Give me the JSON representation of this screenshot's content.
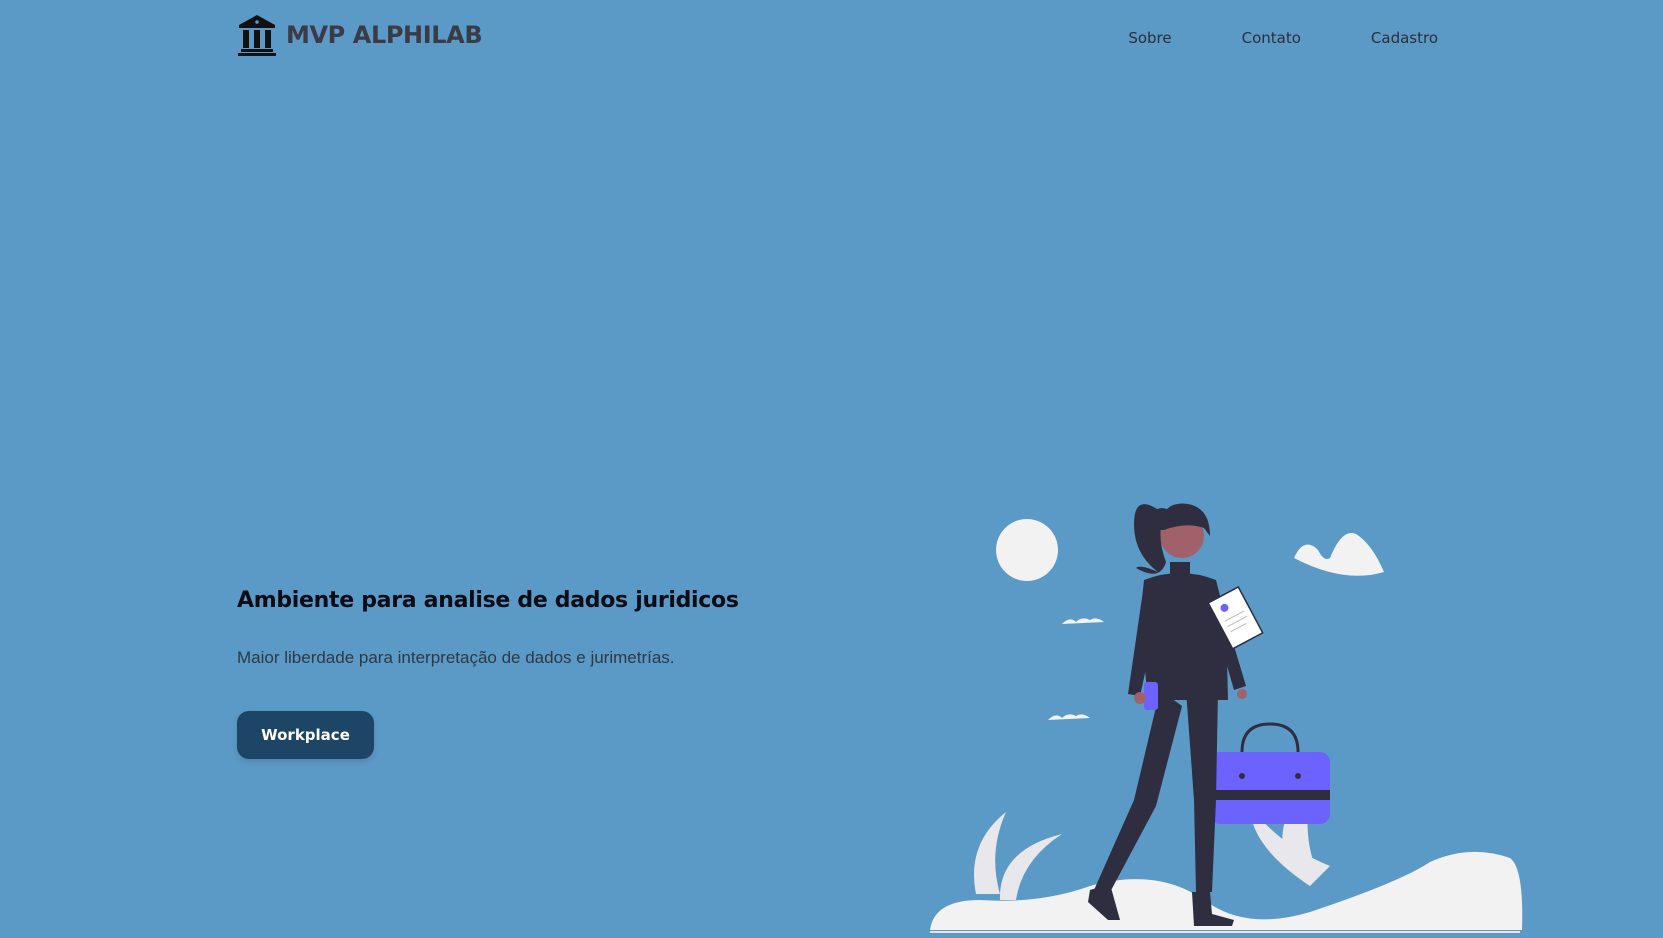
{
  "brand": {
    "name": "MVP ALPHILAB",
    "icon": "courthouse-icon"
  },
  "nav": {
    "items": [
      {
        "label": "Sobre"
      },
      {
        "label": "Contato"
      },
      {
        "label": "Cadastro"
      }
    ]
  },
  "hero": {
    "title": "Ambiente para analise de dados juridicos",
    "subtitle": "Maior liberdade para interpretação de dados e jurimetrías.",
    "cta_label": "Workplace"
  },
  "colors": {
    "background": "#5b9ac6",
    "button": "#1d4566",
    "accent": "#6c63ff",
    "figure": "#2f2e41",
    "cloud": "#f2f2f2"
  }
}
